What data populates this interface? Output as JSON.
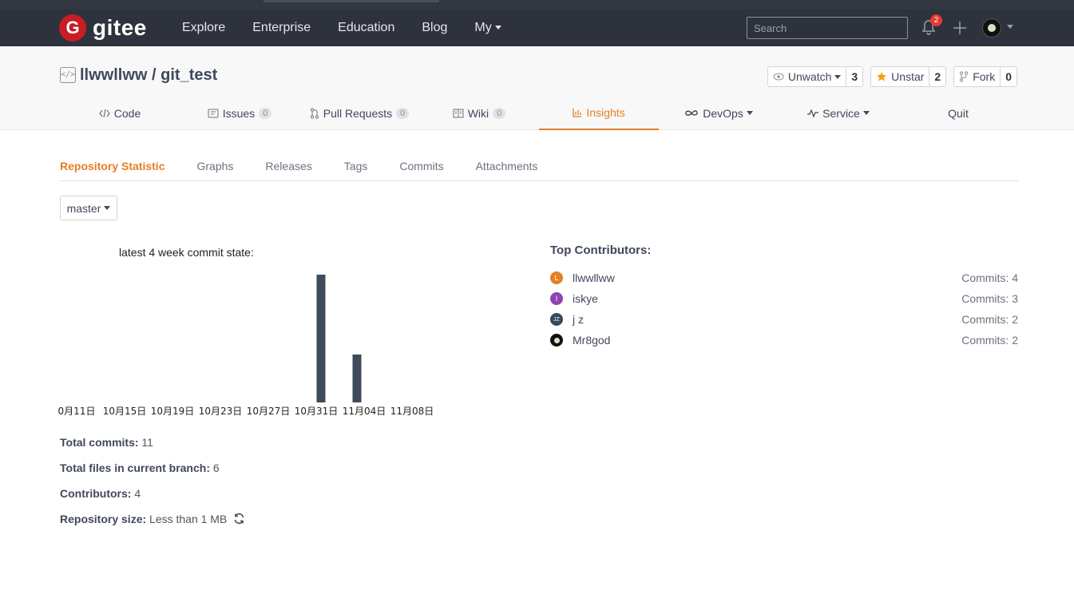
{
  "nav": {
    "logo_letter": "G",
    "logo_text": "gitee",
    "links": [
      "Explore",
      "Enterprise",
      "Education",
      "Blog"
    ],
    "my_label": "My",
    "search_placeholder": "Search",
    "notification_count": "2"
  },
  "repo": {
    "owner": "llwwllww",
    "separator": "/",
    "name": "git_test",
    "actions": {
      "watch": {
        "label": "Unwatch",
        "count": "3"
      },
      "star": {
        "label": "Unstar",
        "count": "2"
      },
      "fork": {
        "label": "Fork",
        "count": "0"
      }
    },
    "tabs": {
      "code": "Code",
      "issues": "Issues",
      "issues_count": "0",
      "pulls": "Pull Requests",
      "pulls_count": "0",
      "wiki": "Wiki",
      "wiki_count": "0",
      "insights": "Insights",
      "devops": "DevOps",
      "service": "Service",
      "quit": "Quit"
    }
  },
  "subnav": [
    "Repository Statistic",
    "Graphs",
    "Releases",
    "Tags",
    "Commits",
    "Attachments"
  ],
  "branch": "master",
  "chart_title": "latest 4 week commit state:",
  "chart_data": {
    "type": "bar",
    "title": "latest 4 week commit state:",
    "tick_labels": [
      "0月11日",
      "10月15日",
      "10月19日",
      "10月23日",
      "10月27日",
      "10月31日",
      "11月04日",
      "11月08日"
    ],
    "bars": [
      {
        "date_index": 5.1,
        "value": 8
      },
      {
        "date_index": 5.85,
        "value": 3
      }
    ],
    "ylim": [
      0,
      8
    ],
    "bar_color": "#3d4b5a"
  },
  "stats": {
    "total_commits_label": "Total commits:",
    "total_commits": "11",
    "total_files_label": "Total files in current branch:",
    "total_files": "6",
    "contributors_label": "Contributors:",
    "contributors": "4",
    "repo_size_label": "Repository size:",
    "repo_size": "Less than 1 MB"
  },
  "contributors_title": "Top Contributors:",
  "contributors": [
    {
      "name": "llwwllww",
      "commits": "Commits: 4",
      "initial": "L",
      "color": "#e67e22"
    },
    {
      "name": "iskye",
      "commits": "Commits: 3",
      "initial": "I",
      "color": "#8e44ad"
    },
    {
      "name": "j z",
      "commits": "Commits: 2",
      "initial": "JZ",
      "color": "#34495e"
    },
    {
      "name": "Mr8god",
      "commits": "Commits: 2",
      "initial": "",
      "color": "#111111"
    }
  ],
  "colors": {
    "accent": "#e67e22",
    "navbar": "#2d323c",
    "logo_red": "#c71d23"
  }
}
